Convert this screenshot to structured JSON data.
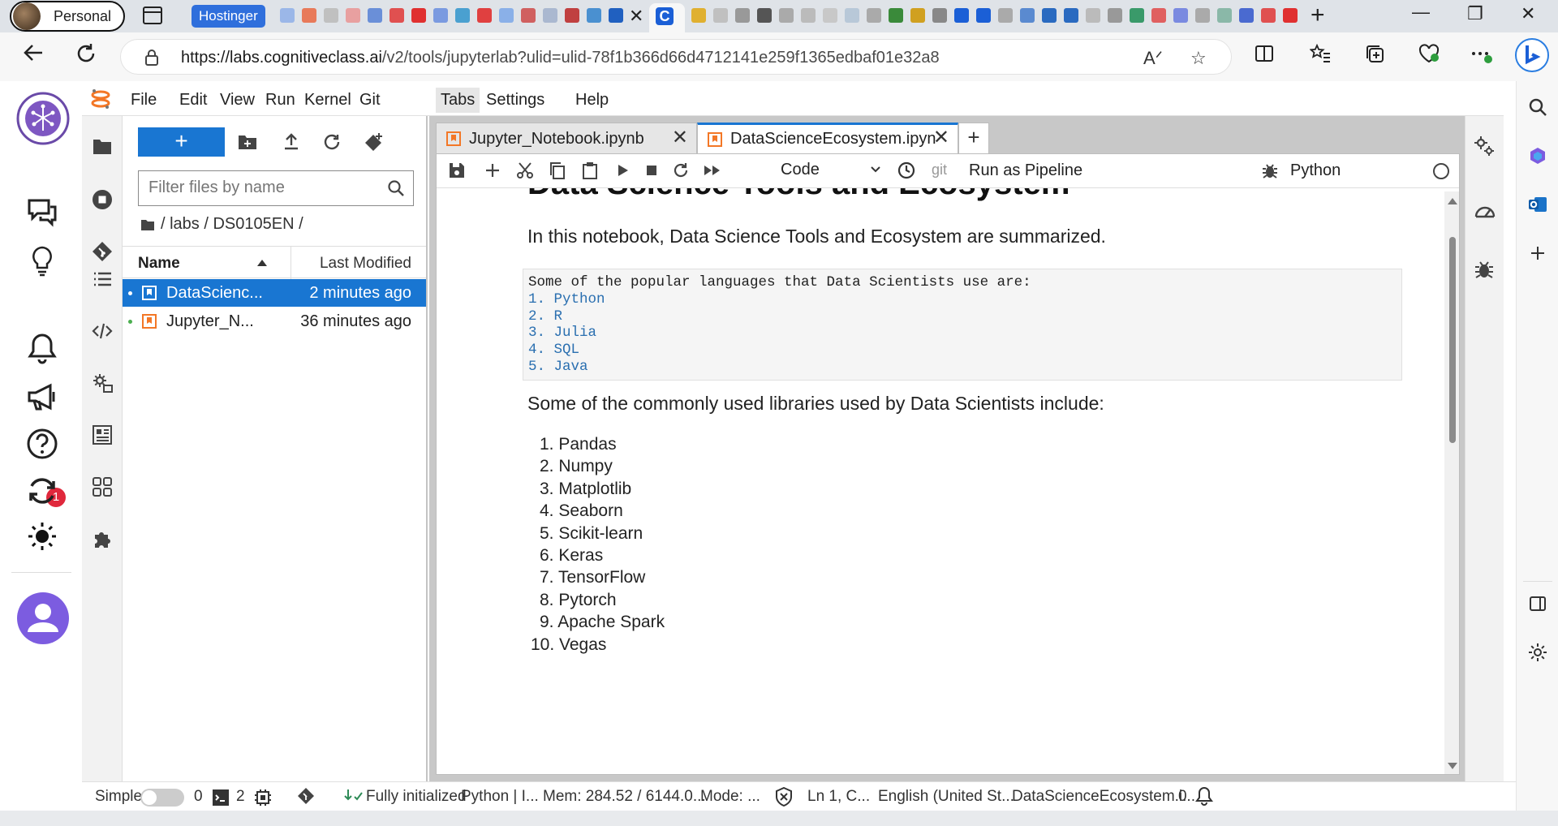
{
  "browser": {
    "profile_label": "Personal",
    "tab_group_label": "Hostinger",
    "url_host": "https://labs.cognitiveclass.ai",
    "url_path": "/v2/tools/jupyterlab?ulid=ulid-78f1b366d66d4712141e259f1365edbaf01e32a8"
  },
  "jupyter": {
    "menu": [
      "File",
      "Edit",
      "View",
      "Run",
      "Kernel",
      "Git",
      "Tabs",
      "Settings",
      "Help"
    ],
    "active_menu": "Tabs"
  },
  "cc_rail": {
    "notification_count": "1"
  },
  "filebrowser": {
    "filter_placeholder": "Filter files by name",
    "breadcrumb": "/ labs / DS0105EN /",
    "col_name": "Name",
    "col_modified": "Last Modified",
    "files": [
      {
        "name": "DataScienc...",
        "modified": "2 minutes ago",
        "selected": true
      },
      {
        "name": "Jupyter_N...",
        "modified": "36 minutes ago",
        "selected": false
      }
    ]
  },
  "tabs": [
    {
      "label": "Jupyter_Notebook.ipynb",
      "active": false
    },
    {
      "label": "DataScienceEcosystem.ipyn",
      "active": true
    }
  ],
  "toolbar": {
    "cell_type": "Code",
    "git_label": "git",
    "pipeline_label": "Run as Pipeline",
    "kernel_label": "Python"
  },
  "notebook": {
    "heading": "Data Science Tools and Ecosystem",
    "intro": "In this notebook, Data Science Tools and Ecosystem are summarized.",
    "code_lines": [
      "Some of the popular languages that Data Scientists use are:",
      "1. Python",
      "2. R",
      "3. Julia",
      "4. SQL",
      "5. Java"
    ],
    "libs_intro": "Some of the commonly used libraries used by Data Scientists include:",
    "libraries": [
      "1. Pandas",
      "2. Numpy",
      "3. Matplotlib",
      "4. Seaborn",
      "5. Scikit-learn",
      "6. Keras",
      "7. TensorFlow",
      "8. Pytorch",
      "9. Apache Spark",
      "10. Vegas"
    ]
  },
  "statusbar": {
    "simple_label": "Simple",
    "terminals_count": "0",
    "kernels_count": "2",
    "init_status": "Fully initialized",
    "kernel_info": "Python | I...",
    "memory": "Mem: 284.52 / 6144.0...",
    "mode": "Mode: ...",
    "cursor": "Ln 1, C...",
    "language": "English (United St...",
    "filename": "DataScienceEcosystem.i...",
    "notifications_count": "0"
  }
}
